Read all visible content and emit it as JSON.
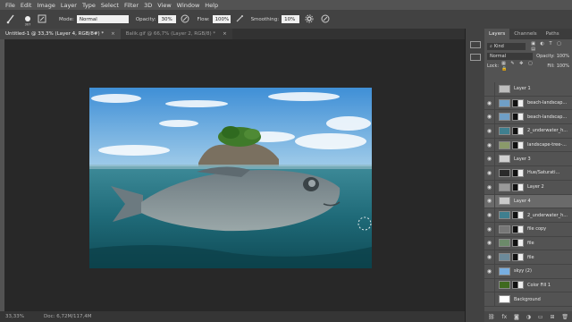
{
  "menu": [
    "File",
    "Edit",
    "Image",
    "Layer",
    "Type",
    "Select",
    "Filter",
    "3D",
    "View",
    "Window",
    "Help"
  ],
  "options": {
    "mode_label": "Mode:",
    "mode_value": "Normal",
    "opacity_label": "Opacity:",
    "opacity_value": "30%",
    "flow_label": "Flow:",
    "flow_value": "100%",
    "smoothing_label": "Smoothing:",
    "smoothing_value": "10%",
    "brush_size": "307"
  },
  "tabs": [
    {
      "label": "Untitled-1 @ 33,3% (Layer 4, RGB/8#) *",
      "close": "×"
    },
    {
      "label": "Balik.gif @ 66,7% (Layer 2, RGB/8) *",
      "close": "×"
    }
  ],
  "status": {
    "zoom": "33,33%",
    "doc": "Doc: 6,72M/117,4M"
  },
  "panel": {
    "tabs": [
      "Layers",
      "Channels",
      "Paths"
    ],
    "kind": "Kind",
    "blend": "Normal",
    "opacity_label": "Opacity:",
    "opacity_value": "100%",
    "lock_label": "Lock:",
    "fill_label": "Fill:",
    "fill_value": "100%"
  },
  "layers": [
    {
      "name": "Layer 1",
      "eye": "",
      "thumb": "#bdbdbd",
      "mask": false,
      "active": false
    },
    {
      "name": "beach-landscap...",
      "eye": "◉",
      "thumb": "#6f9fc7",
      "mask": true,
      "active": false
    },
    {
      "name": "beach-landscap...",
      "eye": "◉",
      "thumb": "#6f9fc7",
      "mask": true,
      "active": false
    },
    {
      "name": "2_underwater_h...",
      "eye": "◉",
      "thumb": "#3f7f8f",
      "mask": true,
      "active": false
    },
    {
      "name": "landscape-tree-...",
      "eye": "◉",
      "thumb": "#8a9a6a",
      "mask": true,
      "active": false
    },
    {
      "name": "Layer 3",
      "eye": "◉",
      "thumb": "#cfcfcf",
      "mask": false,
      "active": false
    },
    {
      "name": "Hue/Saturati...",
      "eye": "◉",
      "thumb": "#2a2a2a",
      "mask": true,
      "active": false
    },
    {
      "name": "Layer 2",
      "eye": "◉",
      "thumb": "#999999",
      "mask": true,
      "active": false
    },
    {
      "name": "Layer 4",
      "eye": "◉",
      "thumb": "#c9c9c9",
      "mask": false,
      "active": true
    },
    {
      "name": "2_underwater_h...",
      "eye": "◉",
      "thumb": "#3f7f8f",
      "mask": true,
      "active": false
    },
    {
      "name": "file copy",
      "eye": "◉",
      "thumb": "#777777",
      "mask": true,
      "active": false
    },
    {
      "name": "file",
      "eye": "◉",
      "thumb": "#6c8a6a",
      "mask": true,
      "active": false
    },
    {
      "name": "file",
      "eye": "◉",
      "thumb": "#6c8a9a",
      "mask": true,
      "active": false
    },
    {
      "name": "skyy (2)",
      "eye": "◉",
      "thumb": "#78aee0",
      "mask": false,
      "active": false
    },
    {
      "name": "Color Fill 1",
      "eye": "",
      "thumb": "#3f6a1f",
      "mask": true,
      "active": false
    },
    {
      "name": "Background",
      "eye": "",
      "thumb": "#ffffff",
      "mask": false,
      "active": false
    }
  ],
  "footer_icons": [
    "link-icon",
    "fx-icon",
    "mask-icon",
    "adjustment-icon",
    "folder-icon",
    "new-layer-icon",
    "trash-icon"
  ]
}
